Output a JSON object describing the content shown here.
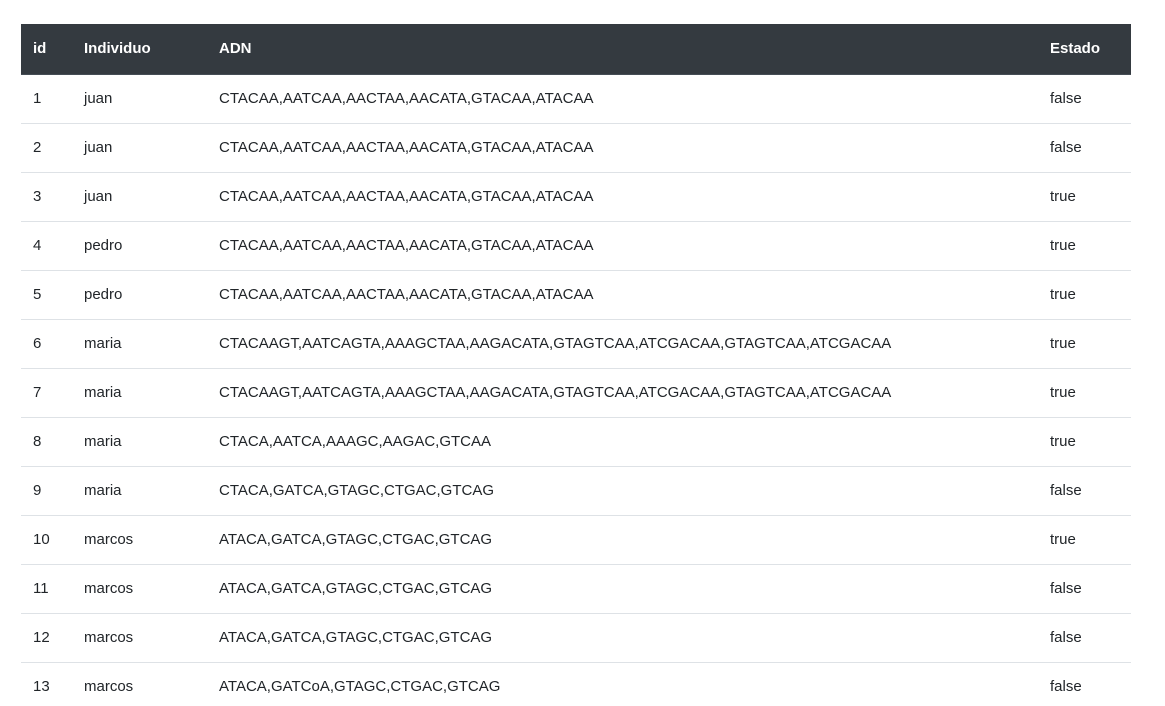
{
  "table": {
    "headers": {
      "id": "id",
      "individuo": "Individuo",
      "adn": "ADN",
      "estado": "Estado"
    },
    "rows": [
      {
        "id": "1",
        "individuo": "juan",
        "adn": "CTACAA,AATCAA,AACTAA,AACATA,GTACAA,ATACAA",
        "estado": "false"
      },
      {
        "id": "2",
        "individuo": "juan",
        "adn": "CTACAA,AATCAA,AACTAA,AACATA,GTACAA,ATACAA",
        "estado": "false"
      },
      {
        "id": "3",
        "individuo": "juan",
        "adn": "CTACAA,AATCAA,AACTAA,AACATA,GTACAA,ATACAA",
        "estado": "true"
      },
      {
        "id": "4",
        "individuo": "pedro",
        "adn": "CTACAA,AATCAA,AACTAA,AACATA,GTACAA,ATACAA",
        "estado": "true"
      },
      {
        "id": "5",
        "individuo": "pedro",
        "adn": "CTACAA,AATCAA,AACTAA,AACATA,GTACAA,ATACAA",
        "estado": "true"
      },
      {
        "id": "6",
        "individuo": "maria",
        "adn": "CTACAAGT,AATCAGTA,AAAGCTAA,AAGACATA,GTAGTCAA,ATCGACAA,GTAGTCAA,ATCGACAA",
        "estado": "true"
      },
      {
        "id": "7",
        "individuo": "maria",
        "adn": "CTACAAGT,AATCAGTA,AAAGCTAA,AAGACATA,GTAGTCAA,ATCGACAA,GTAGTCAA,ATCGACAA",
        "estado": "true"
      },
      {
        "id": "8",
        "individuo": "maria",
        "adn": "CTACA,AATCA,AAAGC,AAGAC,GTCAA",
        "estado": "true"
      },
      {
        "id": "9",
        "individuo": "maria",
        "adn": "CTACA,GATCA,GTAGC,CTGAC,GTCAG",
        "estado": "false"
      },
      {
        "id": "10",
        "individuo": "marcos",
        "adn": "ATACA,GATCA,GTAGC,CTGAC,GTCAG",
        "estado": "true"
      },
      {
        "id": "11",
        "individuo": "marcos",
        "adn": "ATACA,GATCA,GTAGC,CTGAC,GTCAG",
        "estado": "false"
      },
      {
        "id": "12",
        "individuo": "marcos",
        "adn": "ATACA,GATCA,GTAGC,CTGAC,GTCAG",
        "estado": "false"
      },
      {
        "id": "13",
        "individuo": "marcos",
        "adn": "ATACA,GATCoA,GTAGC,CTGAC,GTCAG",
        "estado": "false"
      }
    ]
  },
  "colors": {
    "header_bg": "#343a40",
    "header_text": "#ffffff",
    "row_border": "#dee2e6",
    "body_text": "#212529"
  }
}
